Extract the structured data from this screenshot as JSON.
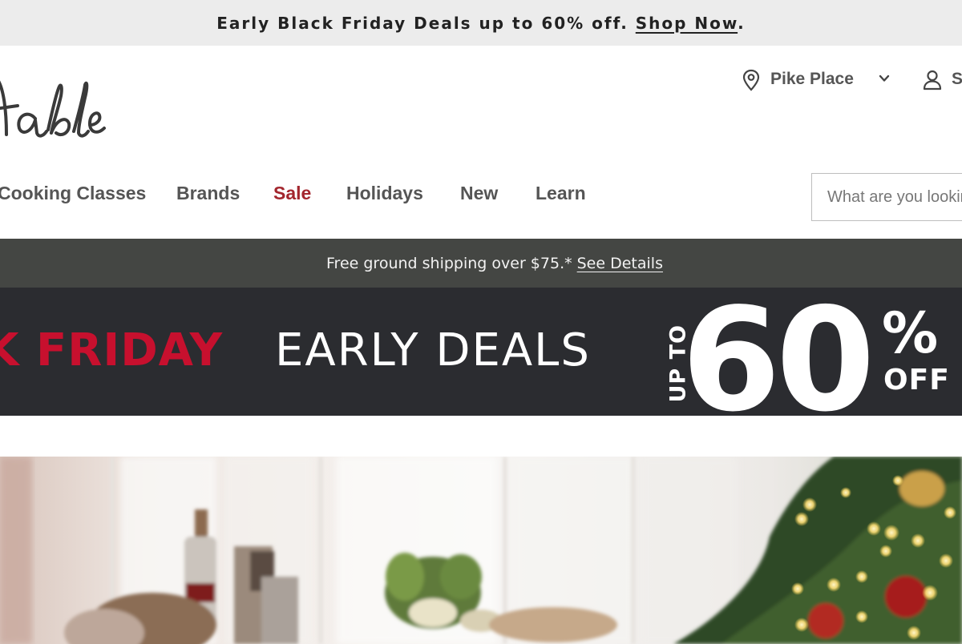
{
  "promo": {
    "text": "Early Black Friday Deals up to 60% off. ",
    "link": "Shop Now",
    "period": "."
  },
  "logo": {
    "text": "table"
  },
  "header": {
    "store": "Pike Place",
    "account_label": "S"
  },
  "nav": {
    "items": [
      {
        "label": "Cooking Classes"
      },
      {
        "label": "Brands"
      },
      {
        "label": "Sale"
      },
      {
        "label": "Holidays"
      },
      {
        "label": "New"
      },
      {
        "label": "Learn"
      }
    ]
  },
  "search": {
    "placeholder": "What are you looking for?"
  },
  "shipping": {
    "text": "Free ground shipping over $75.*",
    "link": "See Details"
  },
  "deal_banner": {
    "red_text": "CK FRIDAY",
    "white_text": "EARLY DEALS",
    "up_to": "UP TO",
    "number": "60",
    "percent": "%",
    "off": "OFF"
  },
  "colors": {
    "sale_red": "#a3262e",
    "banner_red": "#c7102e",
    "banner_bg": "#2b2c30",
    "shipping_bg": "#444643",
    "promo_bg": "#ececec"
  }
}
